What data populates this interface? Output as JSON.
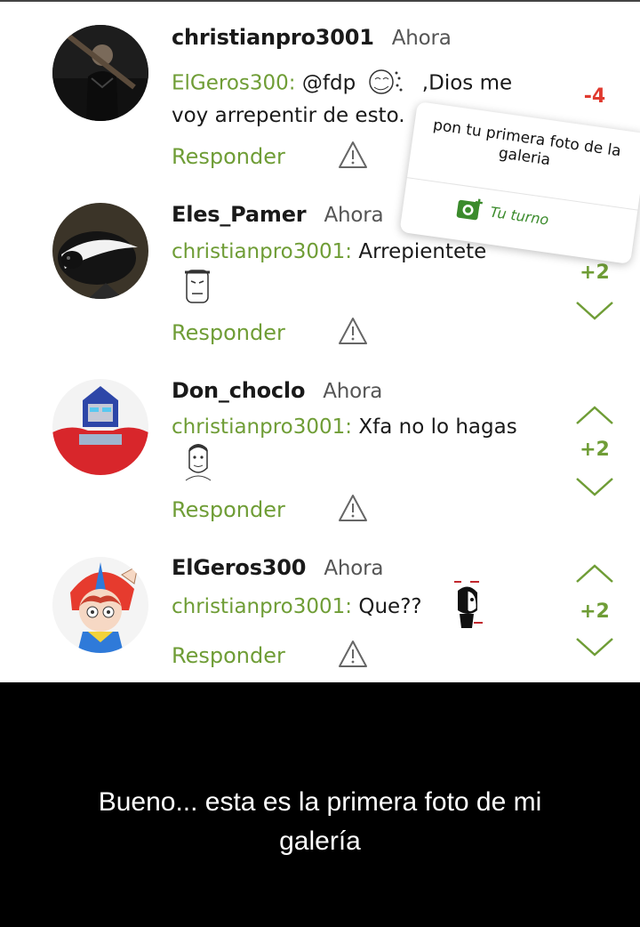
{
  "comments": [
    {
      "username": "christianpro3001",
      "time": "Ahora",
      "text_line1_mention": "ElGeros300:",
      "text_line1_a": "@fdp",
      "text_line1_b": ",Dios me",
      "text_line2": "voy arrepentir de esto.",
      "reply_label": "Responder",
      "score": "-4"
    },
    {
      "username": "Eles_Pamer",
      "time": "Ahora",
      "mention": "christianpro3001:",
      "text": "Arrepientete",
      "reply_label": "Responder",
      "score": "+2"
    },
    {
      "username": "Don_choclo",
      "time": "Ahora",
      "mention": "christianpro3001:",
      "text": "Xfa no lo hagas",
      "reply_label": "Responder",
      "score": "+2"
    },
    {
      "username": "ElGeros300",
      "time": "Ahora",
      "mention": "christianpro3001:",
      "text": "Que??",
      "reply_label": "Responder",
      "score": "+2"
    }
  ],
  "tooltip": {
    "text": "pon tu primera foto de la galeria",
    "button_label": "Tu turno",
    "icon": "camera-add-icon"
  },
  "caption": {
    "line1": "Bueno... esta es la primera foto de mi",
    "line2": "galería"
  },
  "colors": {
    "accent_green": "#6f9d36",
    "negative_red": "#e03a2f",
    "button_green": "#3b8b2c"
  },
  "icons": [
    "warning-triangle-icon",
    "upvote-chevron-icon",
    "downvote-chevron-icon"
  ]
}
